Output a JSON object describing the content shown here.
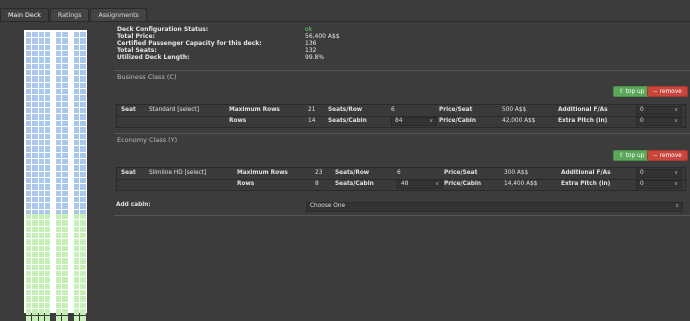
{
  "tabs": [
    "Main Deck",
    "Ratings",
    "Assignments"
  ],
  "status": {
    "rows": [
      {
        "label": "Deck Configuration Status:",
        "value": "ok"
      },
      {
        "label": "Total Price:",
        "value": "56,400 A$$"
      },
      {
        "label": "Certified Passenger Capacity for this deck:",
        "value": "136"
      },
      {
        "label": "Total Seats:",
        "value": "132"
      },
      {
        "label": "Utilized Deck Length:",
        "value": "99.8%"
      }
    ]
  },
  "business": {
    "title": "Business Class (C)",
    "top_up": "top up",
    "remove": "remove",
    "seat_label": "Seat",
    "seat_type": "Standard [select]",
    "max_rows_label": "Maximum Rows",
    "max_rows": "21",
    "seats_row_label": "Seats/Row",
    "seats_row": "6",
    "price_seat_label": "Price/Seat",
    "price_seat": "500 A$$",
    "add_fa_label": "Additional F/As",
    "add_fa": "0",
    "rows_label": "Rows",
    "rows": "14",
    "seats_cabin_label": "Seats/Cabin",
    "seats_cabin": "84",
    "price_cabin_label": "Price/Cabin",
    "price_cabin": "42,000 A$$",
    "pitch_label": "Extra Pitch (in)",
    "pitch": "0"
  },
  "economy": {
    "title": "Economy Class (Y)",
    "top_up": "top up",
    "remove": "remove",
    "seat_label": "Seat",
    "seat_type": "Slimline HD [select]",
    "max_rows_label": "Maximum Rows",
    "max_rows": "23",
    "seats_row_label": "Seats/Row",
    "seats_row": "6",
    "price_seat_label": "Price/Seat",
    "price_seat": "300 A$$",
    "add_fa_label": "Additional F/As",
    "add_fa": "0",
    "rows_label": "Rows",
    "rows": "8",
    "seats_cabin_label": "Seats/Cabin",
    "seats_cabin": "48",
    "price_cabin_label": "Price/Cabin",
    "price_cabin": "14,400 A$$",
    "pitch_label": "Extra Pitch (in)",
    "pitch": "0"
  },
  "add_cabin": {
    "label": "Add cabin:",
    "value": "Choose One"
  },
  "icons": {
    "top_up": "up-arrow-icon",
    "remove": "minus-icon",
    "dropdown": "chevron-down-icon"
  },
  "colors": {
    "business_seat": "#aac8ec",
    "economy_seat": "#c7f0b8",
    "ok": "#6fd16f",
    "top_up": "#5aa85a",
    "remove": "#c9453b"
  }
}
